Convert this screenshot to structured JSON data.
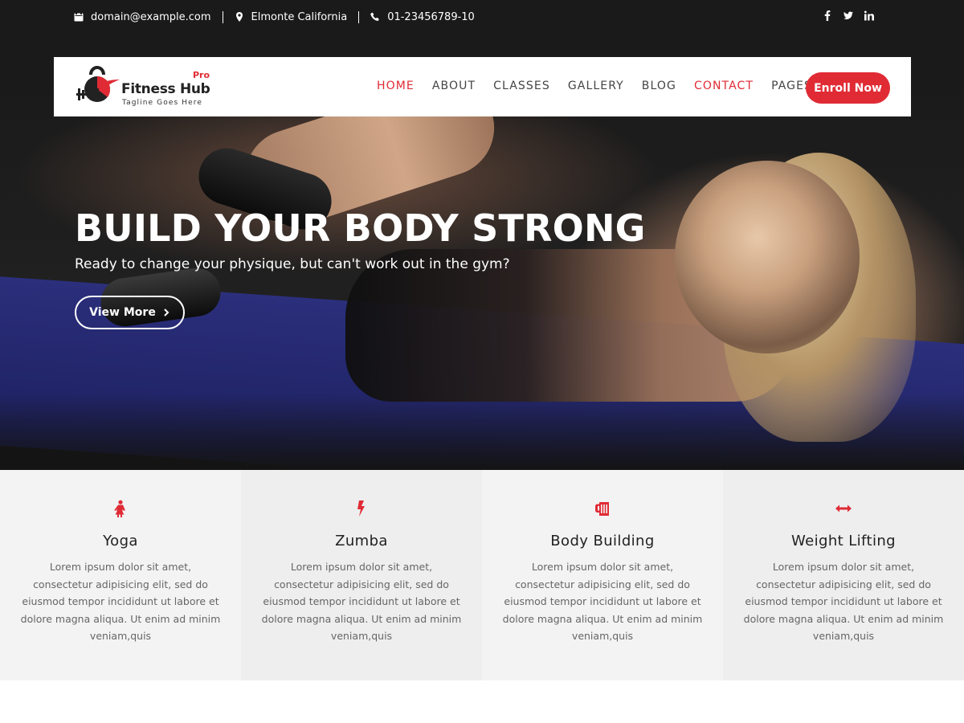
{
  "topbar": {
    "email": "domain@example.com",
    "location": "Elmonte California",
    "phone": "01-23456789-10",
    "social": [
      "facebook-icon",
      "twitter-icon",
      "linkedin-icon"
    ]
  },
  "logo": {
    "title": "Fitness Hub",
    "badge": "Pro",
    "tagline": "Tagline Goes Here"
  },
  "nav": {
    "items": [
      {
        "label": "HOME",
        "active": true
      },
      {
        "label": "ABOUT",
        "active": false
      },
      {
        "label": "CLASSES",
        "active": false
      },
      {
        "label": "GALLERY",
        "active": false
      },
      {
        "label": "BLOG",
        "active": false
      },
      {
        "label": "CONTACT",
        "active": true
      },
      {
        "label": "PAGES",
        "active": false,
        "dropdown": true
      }
    ],
    "cta": "Enroll Now"
  },
  "hero": {
    "title": "BUILD YOUR BODY STRONG",
    "subtitle": "Ready to change your physique, but can't work out in the gym?",
    "button": "View More"
  },
  "features": [
    {
      "icon": "female-icon",
      "title": "Yoga",
      "text": "Lorem ipsum dolor sit amet, consectetur adipisicing elit, sed do eiusmod tempor incididunt ut labore et dolore magna aliqua. Ut enim ad minim veniam,quis"
    },
    {
      "icon": "bolt-icon",
      "title": "Zumba",
      "text": "Lorem ipsum dolor sit amet, consectetur adipisicing elit, sed do eiusmod tempor incididunt ut labore et dolore magna aliqua. Ut enim ad minim veniam,quis"
    },
    {
      "icon": "beer-mug-icon",
      "title": "Body Building",
      "text": "Lorem ipsum dolor sit amet, consectetur adipisicing elit, sed do eiusmod tempor incididunt ut labore et dolore magna aliqua. Ut enim ad minim veniam,quis"
    },
    {
      "icon": "horizontal-arrows-icon",
      "title": "Weight Lifting",
      "text": "Lorem ipsum dolor sit amet, consectetur adipisicing elit, sed do eiusmod tempor incididunt ut labore et dolore magna aliqua. Ut enim ad minim veniam,quis"
    }
  ],
  "colors": {
    "accent": "#e02b35",
    "topbar": "#1a1a1a",
    "feature_bg_light": "#f3f3f3",
    "feature_bg_dark": "#eeeeee"
  }
}
